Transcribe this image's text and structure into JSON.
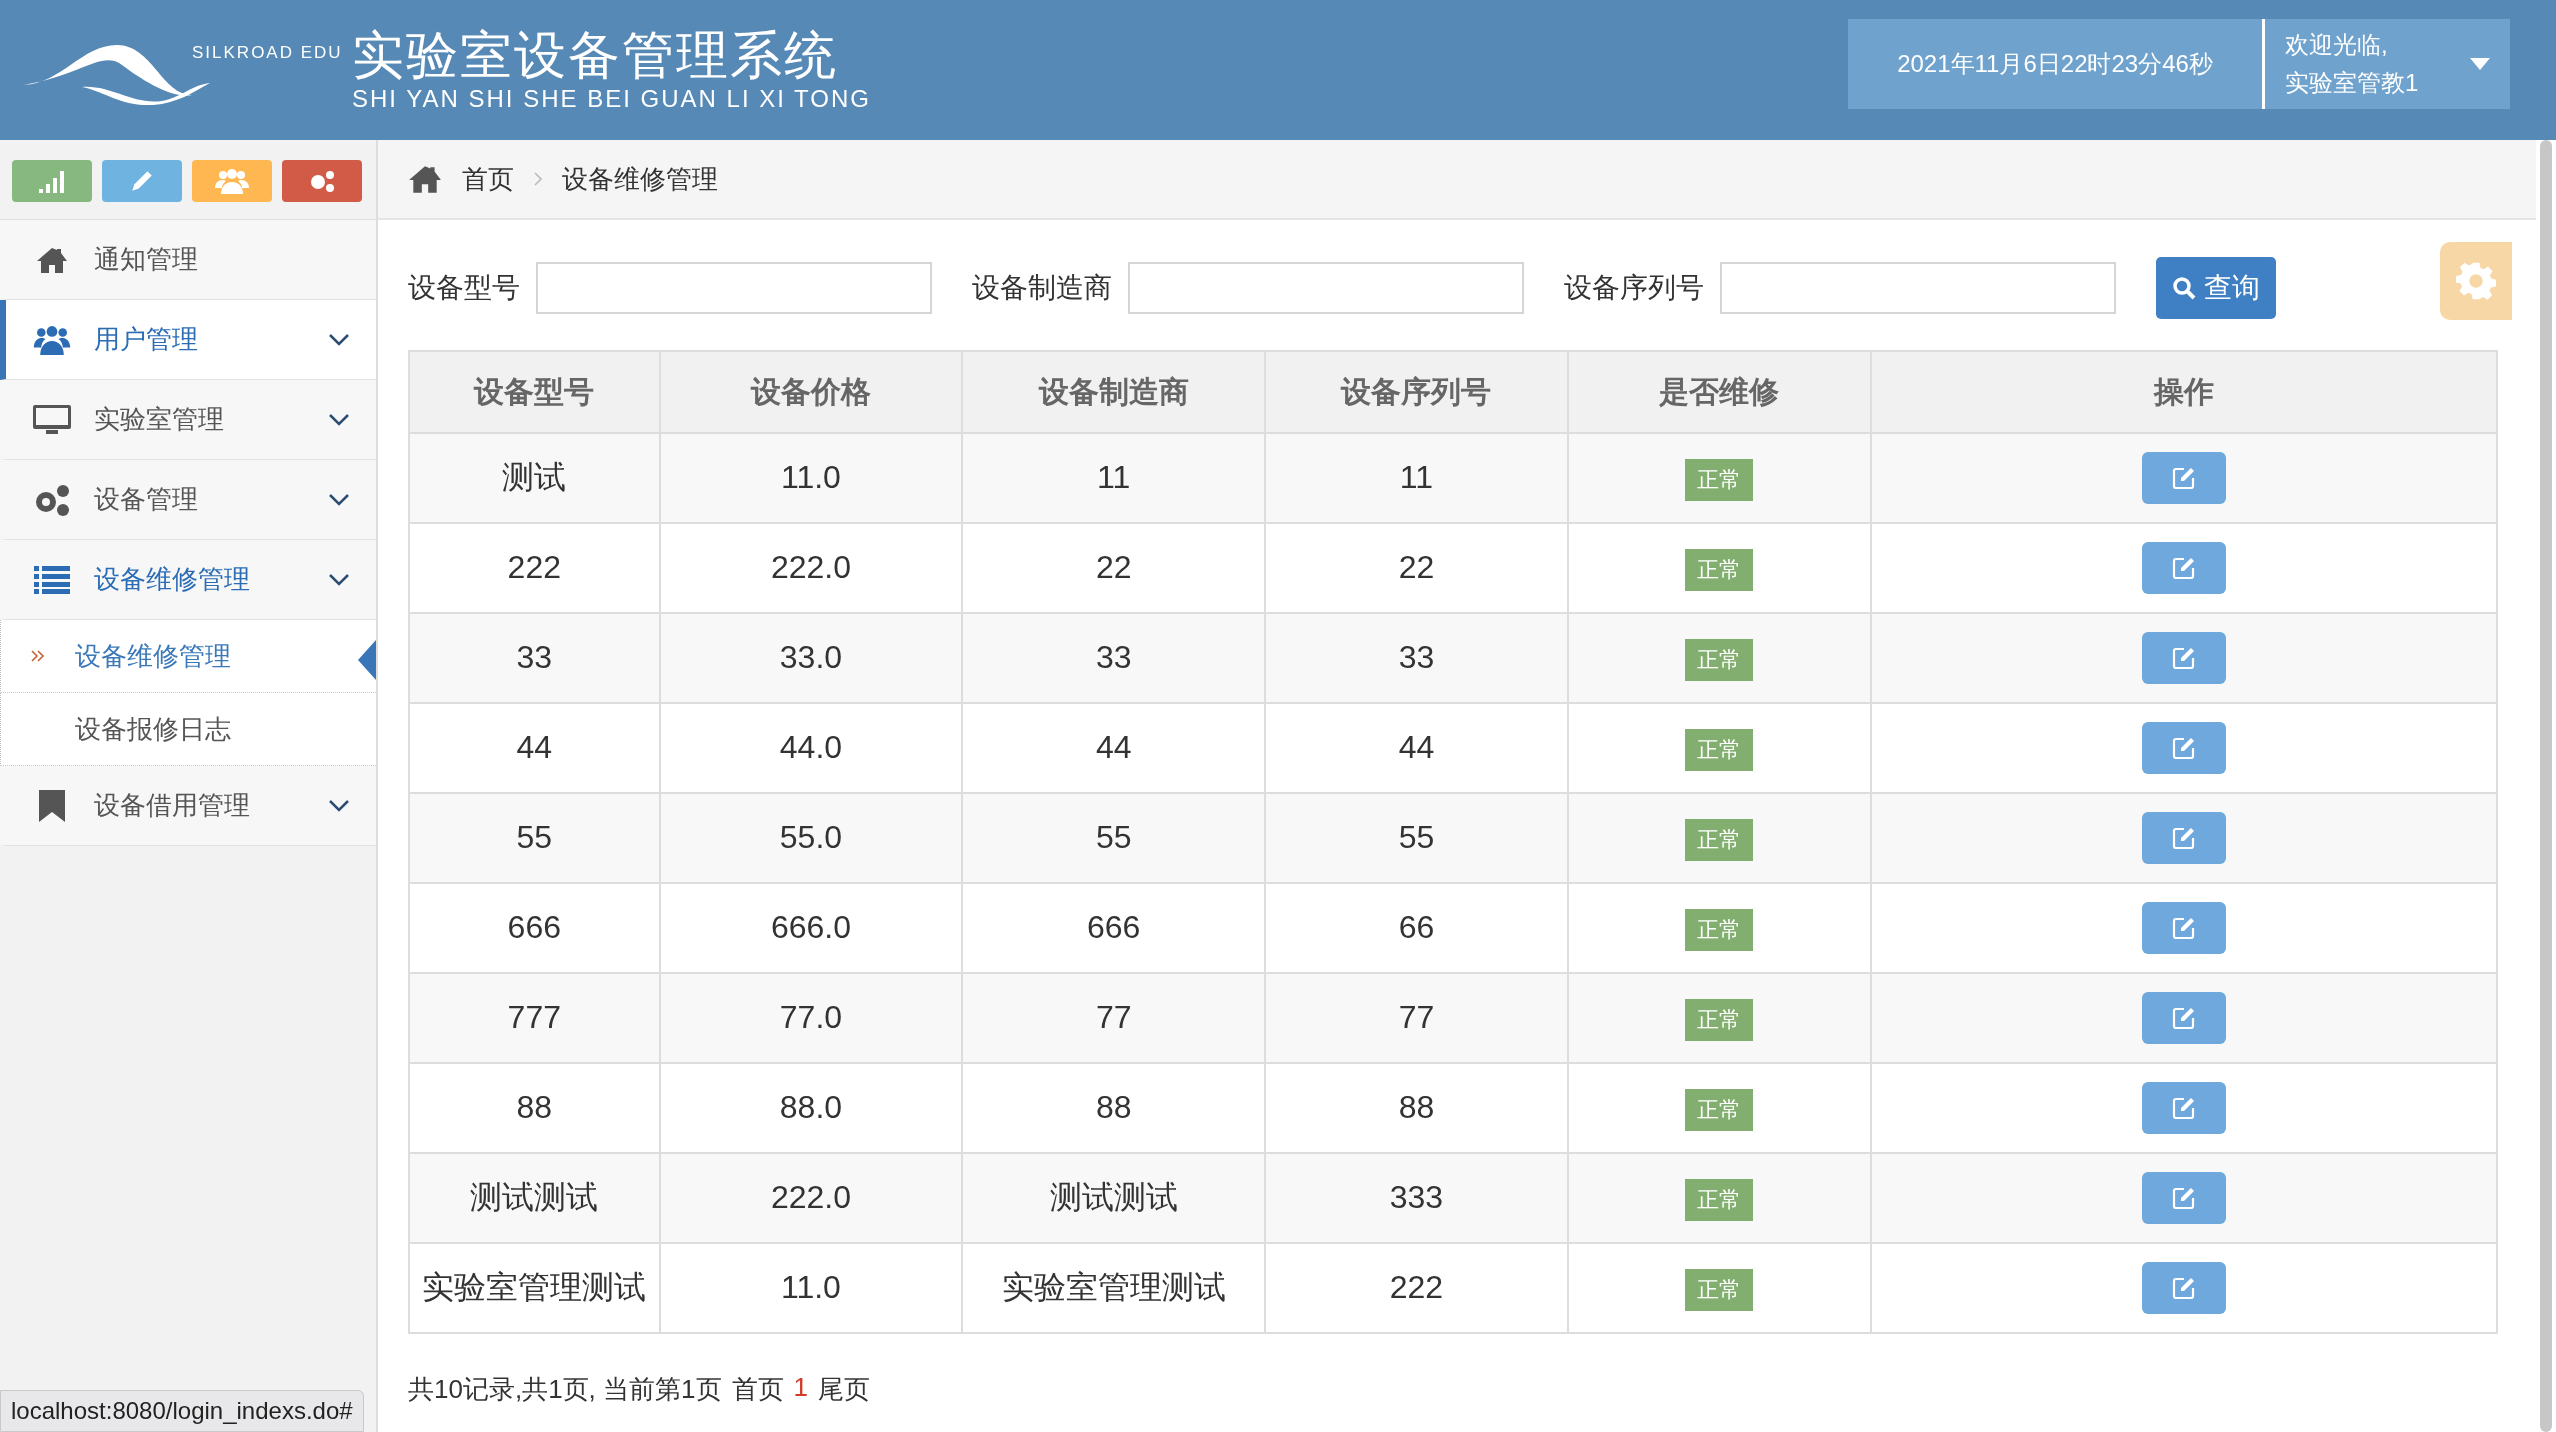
{
  "header": {
    "logo_text": "SILKROAD EDU",
    "title": "实验室设备管理系统",
    "subtitle": "SHI YAN SHI SHE BEI GUAN LI XI TONG",
    "datetime": "2021年11月6日22时23分46秒",
    "welcome": "欢迎光临,",
    "user": "实验室管教1"
  },
  "shortcuts": [
    {
      "color": "#87b87f"
    },
    {
      "color": "#6fb3e0"
    },
    {
      "color": "#ffb752"
    },
    {
      "color": "#d15b47"
    }
  ],
  "sidebar": {
    "items": [
      {
        "label": "通知管理",
        "selected": false,
        "expanded": false,
        "has_children": false
      },
      {
        "label": "用户管理",
        "selected": true,
        "expanded": false,
        "has_children": true
      },
      {
        "label": "实验室管理",
        "selected": false,
        "expanded": false,
        "has_children": true
      },
      {
        "label": "设备管理",
        "selected": false,
        "expanded": false,
        "has_children": true
      },
      {
        "label": "设备维修管理",
        "selected": false,
        "expanded": true,
        "has_children": true,
        "children": [
          {
            "label": "设备维修管理",
            "selected": true
          },
          {
            "label": "设备报修日志",
            "selected": false
          }
        ]
      },
      {
        "label": "设备借用管理",
        "selected": false,
        "expanded": false,
        "has_children": true
      }
    ]
  },
  "breadcrumb": [
    "首页",
    "设备维修管理"
  ],
  "search": {
    "fields": [
      {
        "label": "设备型号"
      },
      {
        "label": "设备制造商"
      },
      {
        "label": "设备序列号"
      }
    ],
    "button": "查询"
  },
  "table": {
    "columns": [
      "设备型号",
      "设备价格",
      "设备制造商",
      "设备序列号",
      "是否维修",
      "操作"
    ],
    "rows": [
      {
        "model": "测试",
        "price": "11.0",
        "maker": "11",
        "serial": "11",
        "status": "正常"
      },
      {
        "model": "222",
        "price": "222.0",
        "maker": "22",
        "serial": "22",
        "status": "正常"
      },
      {
        "model": "33",
        "price": "33.0",
        "maker": "33",
        "serial": "33",
        "status": "正常"
      },
      {
        "model": "44",
        "price": "44.0",
        "maker": "44",
        "serial": "44",
        "status": "正常"
      },
      {
        "model": "55",
        "price": "55.0",
        "maker": "55",
        "serial": "55",
        "status": "正常"
      },
      {
        "model": "666",
        "price": "666.0",
        "maker": "666",
        "serial": "66",
        "status": "正常"
      },
      {
        "model": "777",
        "price": "77.0",
        "maker": "77",
        "serial": "77",
        "status": "正常"
      },
      {
        "model": "88",
        "price": "88.0",
        "maker": "88",
        "serial": "88",
        "status": "正常"
      },
      {
        "model": "测试测试",
        "price": "222.0",
        "maker": "测试测试",
        "serial": "333",
        "status": "正常"
      },
      {
        "model": "实验室管理测试",
        "price": "11.0",
        "maker": "实验室管理测试",
        "serial": "222",
        "status": "正常"
      }
    ]
  },
  "pagination": {
    "summary": "共10记录,共1页, 当前第1页",
    "first": "首页",
    "pages": [
      {
        "label": "1",
        "selected": true
      }
    ],
    "last": "尾页"
  },
  "status_bar": {
    "url": "localhost:8080/login_indexs.do#"
  }
}
